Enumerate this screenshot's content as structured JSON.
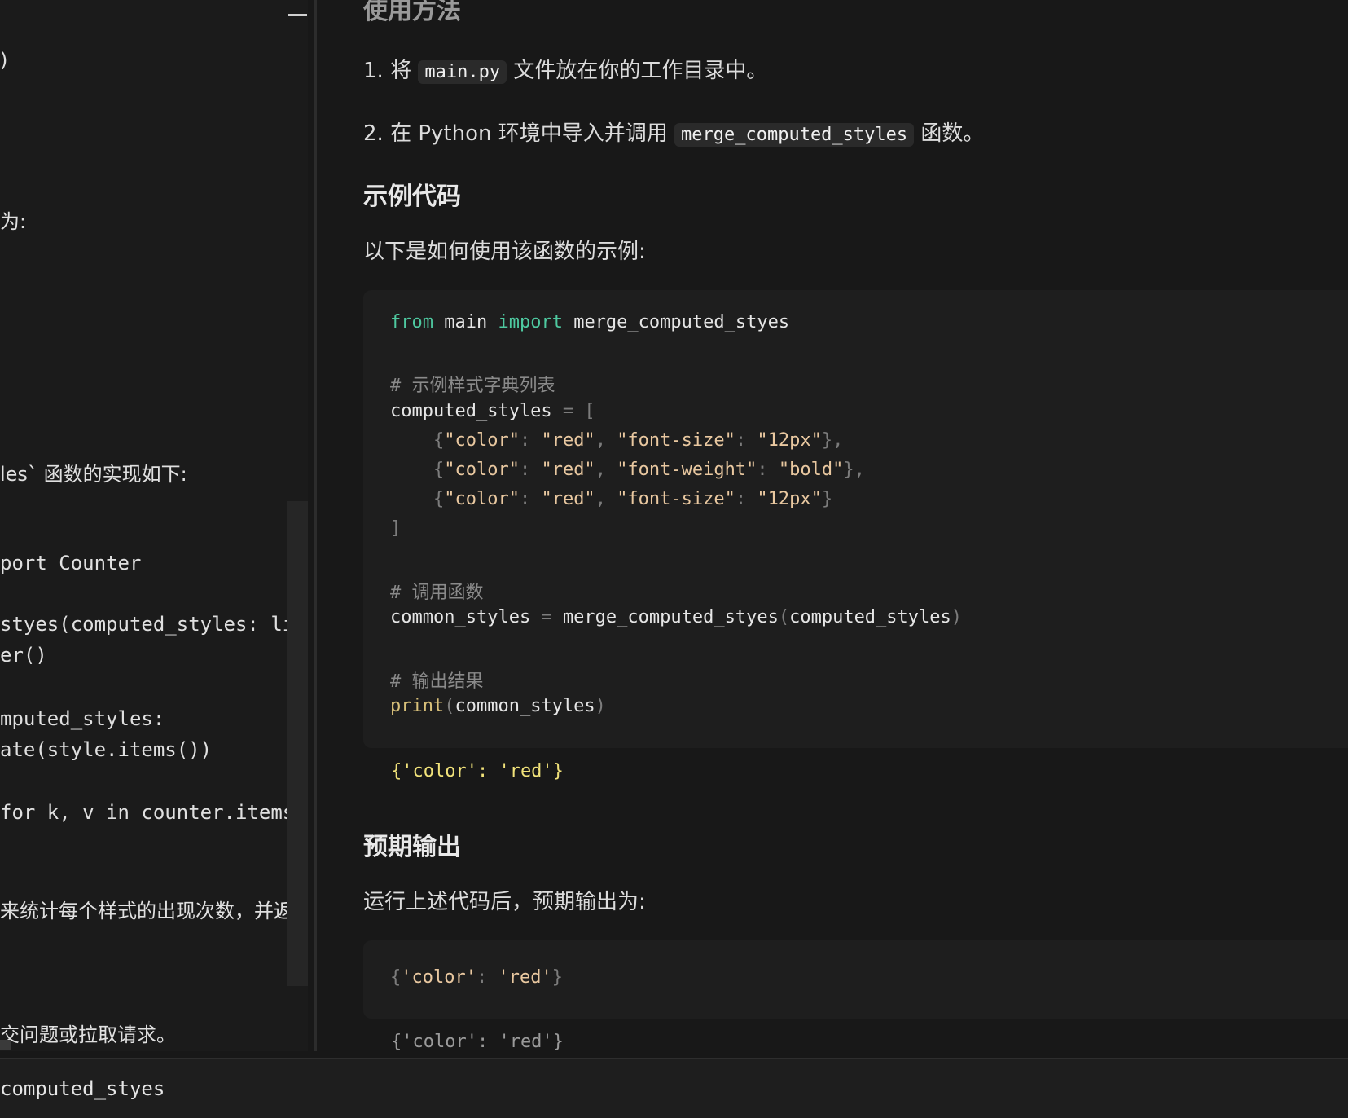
{
  "left_pane": {
    "lines": [
      {
        "text": ")",
        "kind": "text"
      },
      {
        "text": "为:",
        "kind": "text"
      },
      {
        "text": "les`  函数的实现如下:",
        "kind": "text"
      },
      {
        "text": "port Counter",
        "kind": "code"
      },
      {
        "text": "styes(computed_styles: lis",
        "kind": "code"
      },
      {
        "text": "er()",
        "kind": "code"
      },
      {
        "text": "mputed_styles:",
        "kind": "code"
      },
      {
        "text": "ate(style.items())",
        "kind": "code"
      },
      {
        "text": "for k, v in counter.items(",
        "kind": "code"
      },
      {
        "text": "来统计每个样式的出现次数，并返回",
        "kind": "text"
      },
      {
        "text": "交问题或拉取请求。",
        "kind": "text"
      }
    ]
  },
  "right_pane": {
    "section_usage": "使用方法",
    "step1": {
      "num": "1.",
      "pre": "将",
      "code": "main.py",
      "post": "文件放在你的工作目录中。"
    },
    "step2": {
      "num": "2.",
      "pre": "在 Python 环境中导入并调用",
      "code": "merge_computed_styles",
      "post": "函数。"
    },
    "section_example": "示例代码",
    "example_intro": "以下是如何使用该函数的示例:",
    "code": {
      "l1": {
        "kw1": "from",
        "mod": " main ",
        "kw2": "import",
        "name": " merge_computed_styes"
      },
      "c1": "# 示例样式字典列表",
      "l2": {
        "name": "computed_styles",
        "op": " = ["
      },
      "r1": {
        "k1": "\"color\"",
        "v1": "\"red\"",
        "k2": "\"font-size\"",
        "v2": "\"12px\""
      },
      "r2": {
        "k1": "\"color\"",
        "v1": "\"red\"",
        "k2": "\"font-weight\"",
        "v2": "\"bold\""
      },
      "r3": {
        "k1": "\"color\"",
        "v1": "\"red\"",
        "k2": "\"font-size\"",
        "v2": "\"12px\""
      },
      "close": "]",
      "c2": "# 调用函数",
      "l3": {
        "lhs": "common_styles",
        "op": " = ",
        "fn": "merge_computed_styes",
        "arg": "computed_styles"
      },
      "c3": "# 输出结果",
      "l4": {
        "fn": "print",
        "arg": "common_styles"
      }
    },
    "run_output": "{'color': 'red'}",
    "section_expected": "预期输出",
    "expected_intro": "运行上述代码后，预期输出为:",
    "expected_code": {
      "open": "{",
      "k": "'color'",
      "sep": ": ",
      "v": "'red'",
      "close": "}"
    },
    "expected_output": "{'color': 'red'}"
  },
  "bottom_bar": {
    "text": "computed_styes"
  }
}
